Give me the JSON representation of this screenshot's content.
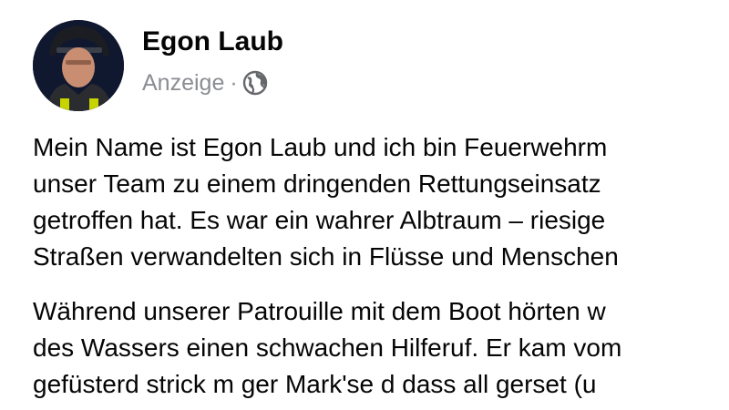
{
  "post": {
    "author": "Egon Laub",
    "sponsored_label": "Anzeige",
    "separator": "·",
    "privacy_icon": "globe-icon",
    "paragraphs": [
      {
        "lines": [
          "Mein Name ist Egon Laub und ich bin Feuerwehrm",
          "unser Team zu einem dringenden Rettungseinsatz",
          "getroffen hat. Es war ein wahrer Albtraum – riesige",
          "Straßen verwandelten sich in Flüsse und Menschen"
        ]
      },
      {
        "lines": [
          "Während unserer Patrouille mit dem Boot hörten w",
          "des Wassers einen schwachen Hilferuf. Er kam vom",
          "gefüsterd strick m ger Mark'se d  dass all gerset (u"
        ]
      }
    ]
  },
  "colors": {
    "text_primary": "#050505",
    "text_secondary": "#8a8d91",
    "background": "#ffffff"
  }
}
